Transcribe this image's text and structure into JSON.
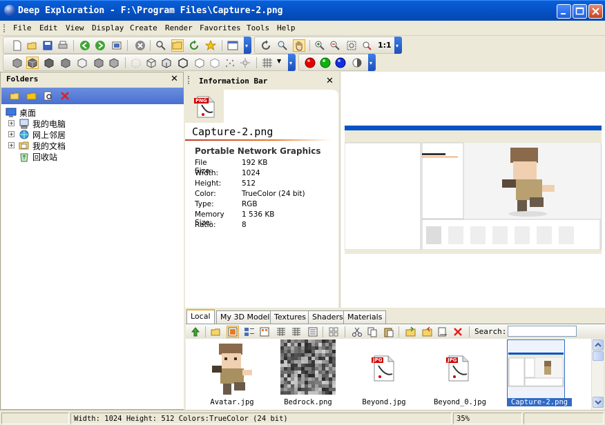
{
  "window": {
    "title": "Deep Exploration - F:\\Program Files\\Capture-2.png"
  },
  "menu": [
    "File",
    "Edit",
    "View",
    "Display",
    "Create",
    "Render",
    "Favorites",
    "Tools",
    "Help"
  ],
  "toolbar": {
    "zoom_1to1_label": "1:1"
  },
  "folders": {
    "title": "Folders",
    "items": [
      {
        "label": "桌面",
        "icon": "desktop-icon",
        "expandable": false
      },
      {
        "label": "我的电脑",
        "icon": "my-computer-icon",
        "expandable": true
      },
      {
        "label": "网上邻居",
        "icon": "network-icon",
        "expandable": true
      },
      {
        "label": "我的文档",
        "icon": "my-documents-icon",
        "expandable": true
      },
      {
        "label": "回收站",
        "icon": "recycle-bin-icon",
        "expandable": false
      }
    ]
  },
  "info": {
    "title": "Information Bar",
    "file_badge": "PNG",
    "file_name": "Capture-2.png",
    "format": "Portable Network Graphics",
    "rows": [
      {
        "key": "File Size:",
        "value": "192 KB"
      },
      {
        "key": "Width:",
        "value": "1024"
      },
      {
        "key": "Height:",
        "value": "512"
      },
      {
        "key": "Color:",
        "value": "TrueColor (24 bit)"
      },
      {
        "key": "Type:",
        "value": "RGB"
      },
      {
        "key": "Memory Size:",
        "value": "1 536 KB"
      },
      {
        "key": "Ratio:",
        "value": "8"
      }
    ]
  },
  "tabs": [
    "Local",
    "My 3D Models",
    "Textures",
    "Shaders",
    "Materials"
  ],
  "search": {
    "label": "Search:",
    "value": ""
  },
  "thumbnails": [
    {
      "label": "Avatar.jpg",
      "kind": "avatar"
    },
    {
      "label": "Bedrock.png",
      "kind": "noise"
    },
    {
      "label": "Beyond.jpg",
      "kind": "jpg-icon",
      "badge": "JPG"
    },
    {
      "label": "Beyond_0.jpg",
      "kind": "jpg-icon",
      "badge": "JPG"
    },
    {
      "label": "Capture-2.png",
      "kind": "screenshot",
      "selected": true
    }
  ],
  "status": {
    "info": "Width: 1024 Height: 512 Colors:TrueColor (24 bit)",
    "zoom": "35%"
  },
  "colors": {
    "title_bar": "#0653c7",
    "selection": "#316ac5",
    "accent_orange": "#e8792a"
  }
}
